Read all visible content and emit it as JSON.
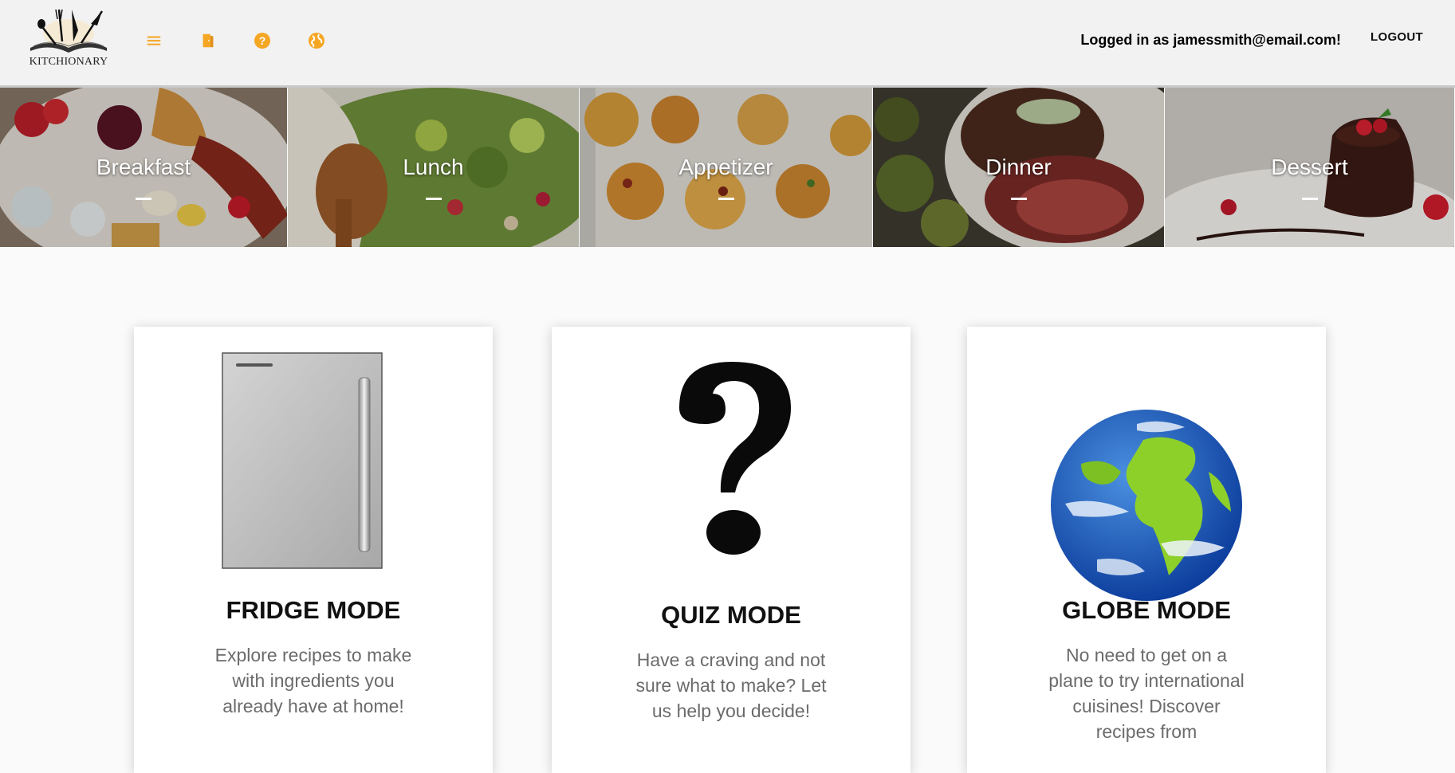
{
  "header": {
    "logo_text": "KITCHIONARY",
    "login_text": "Logged in as jamessmith@email.com!",
    "logout_label": "LOGOUT",
    "accent_color": "#f5a623",
    "icons": [
      "menu-icon",
      "door-icon",
      "help-icon",
      "globe-icon"
    ]
  },
  "categories": [
    {
      "label": "Breakfast"
    },
    {
      "label": "Lunch"
    },
    {
      "label": "Appetizer"
    },
    {
      "label": "Dinner"
    },
    {
      "label": "Dessert"
    }
  ],
  "modes": [
    {
      "title": "FRIDGE MODE",
      "description": "Explore recipes to make with ingredients you already have at home!"
    },
    {
      "title": "QUIZ MODE",
      "description": "Have a craving and not sure what to make? Let us help you decide!"
    },
    {
      "title": "GLOBE MODE",
      "description": "No need to get on a plane to try international cuisines! Discover recipes from"
    }
  ]
}
